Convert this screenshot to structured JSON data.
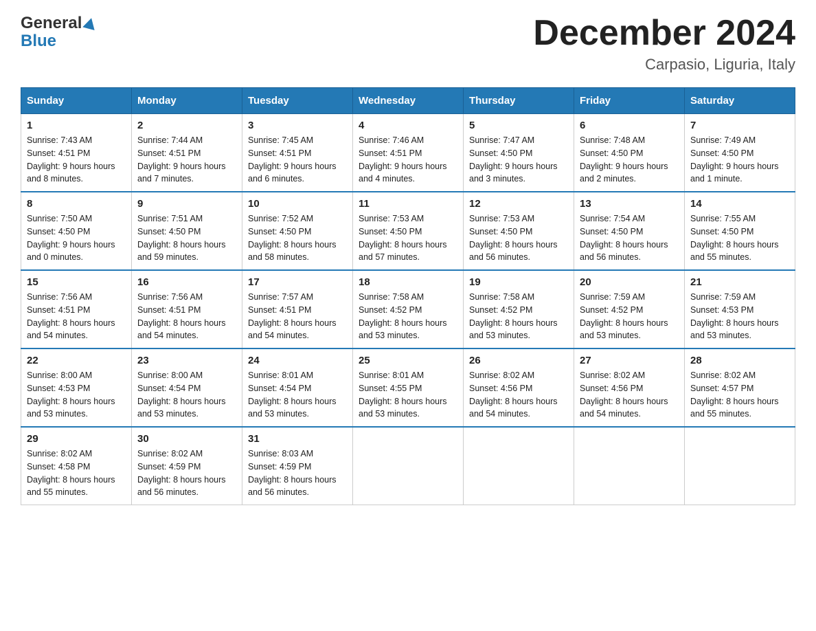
{
  "header": {
    "month_title": "December 2024",
    "location": "Carpasio, Liguria, Italy",
    "logo_general": "General",
    "logo_blue": "Blue"
  },
  "days_of_week": [
    "Sunday",
    "Monday",
    "Tuesday",
    "Wednesday",
    "Thursday",
    "Friday",
    "Saturday"
  ],
  "weeks": [
    [
      {
        "day": "1",
        "sunrise": "7:43 AM",
        "sunset": "4:51 PM",
        "daylight": "9 hours and 8 minutes."
      },
      {
        "day": "2",
        "sunrise": "7:44 AM",
        "sunset": "4:51 PM",
        "daylight": "9 hours and 7 minutes."
      },
      {
        "day": "3",
        "sunrise": "7:45 AM",
        "sunset": "4:51 PM",
        "daylight": "9 hours and 6 minutes."
      },
      {
        "day": "4",
        "sunrise": "7:46 AM",
        "sunset": "4:51 PM",
        "daylight": "9 hours and 4 minutes."
      },
      {
        "day": "5",
        "sunrise": "7:47 AM",
        "sunset": "4:50 PM",
        "daylight": "9 hours and 3 minutes."
      },
      {
        "day": "6",
        "sunrise": "7:48 AM",
        "sunset": "4:50 PM",
        "daylight": "9 hours and 2 minutes."
      },
      {
        "day": "7",
        "sunrise": "7:49 AM",
        "sunset": "4:50 PM",
        "daylight": "9 hours and 1 minute."
      }
    ],
    [
      {
        "day": "8",
        "sunrise": "7:50 AM",
        "sunset": "4:50 PM",
        "daylight": "9 hours and 0 minutes."
      },
      {
        "day": "9",
        "sunrise": "7:51 AM",
        "sunset": "4:50 PM",
        "daylight": "8 hours and 59 minutes."
      },
      {
        "day": "10",
        "sunrise": "7:52 AM",
        "sunset": "4:50 PM",
        "daylight": "8 hours and 58 minutes."
      },
      {
        "day": "11",
        "sunrise": "7:53 AM",
        "sunset": "4:50 PM",
        "daylight": "8 hours and 57 minutes."
      },
      {
        "day": "12",
        "sunrise": "7:53 AM",
        "sunset": "4:50 PM",
        "daylight": "8 hours and 56 minutes."
      },
      {
        "day": "13",
        "sunrise": "7:54 AM",
        "sunset": "4:50 PM",
        "daylight": "8 hours and 56 minutes."
      },
      {
        "day": "14",
        "sunrise": "7:55 AM",
        "sunset": "4:50 PM",
        "daylight": "8 hours and 55 minutes."
      }
    ],
    [
      {
        "day": "15",
        "sunrise": "7:56 AM",
        "sunset": "4:51 PM",
        "daylight": "8 hours and 54 minutes."
      },
      {
        "day": "16",
        "sunrise": "7:56 AM",
        "sunset": "4:51 PM",
        "daylight": "8 hours and 54 minutes."
      },
      {
        "day": "17",
        "sunrise": "7:57 AM",
        "sunset": "4:51 PM",
        "daylight": "8 hours and 54 minutes."
      },
      {
        "day": "18",
        "sunrise": "7:58 AM",
        "sunset": "4:52 PM",
        "daylight": "8 hours and 53 minutes."
      },
      {
        "day": "19",
        "sunrise": "7:58 AM",
        "sunset": "4:52 PM",
        "daylight": "8 hours and 53 minutes."
      },
      {
        "day": "20",
        "sunrise": "7:59 AM",
        "sunset": "4:52 PM",
        "daylight": "8 hours and 53 minutes."
      },
      {
        "day": "21",
        "sunrise": "7:59 AM",
        "sunset": "4:53 PM",
        "daylight": "8 hours and 53 minutes."
      }
    ],
    [
      {
        "day": "22",
        "sunrise": "8:00 AM",
        "sunset": "4:53 PM",
        "daylight": "8 hours and 53 minutes."
      },
      {
        "day": "23",
        "sunrise": "8:00 AM",
        "sunset": "4:54 PM",
        "daylight": "8 hours and 53 minutes."
      },
      {
        "day": "24",
        "sunrise": "8:01 AM",
        "sunset": "4:54 PM",
        "daylight": "8 hours and 53 minutes."
      },
      {
        "day": "25",
        "sunrise": "8:01 AM",
        "sunset": "4:55 PM",
        "daylight": "8 hours and 53 minutes."
      },
      {
        "day": "26",
        "sunrise": "8:02 AM",
        "sunset": "4:56 PM",
        "daylight": "8 hours and 54 minutes."
      },
      {
        "day": "27",
        "sunrise": "8:02 AM",
        "sunset": "4:56 PM",
        "daylight": "8 hours and 54 minutes."
      },
      {
        "day": "28",
        "sunrise": "8:02 AM",
        "sunset": "4:57 PM",
        "daylight": "8 hours and 55 minutes."
      }
    ],
    [
      {
        "day": "29",
        "sunrise": "8:02 AM",
        "sunset": "4:58 PM",
        "daylight": "8 hours and 55 minutes."
      },
      {
        "day": "30",
        "sunrise": "8:02 AM",
        "sunset": "4:59 PM",
        "daylight": "8 hours and 56 minutes."
      },
      {
        "day": "31",
        "sunrise": "8:03 AM",
        "sunset": "4:59 PM",
        "daylight": "8 hours and 56 minutes."
      },
      null,
      null,
      null,
      null
    ]
  ],
  "labels": {
    "sunrise": "Sunrise:",
    "sunset": "Sunset:",
    "daylight": "Daylight:"
  }
}
